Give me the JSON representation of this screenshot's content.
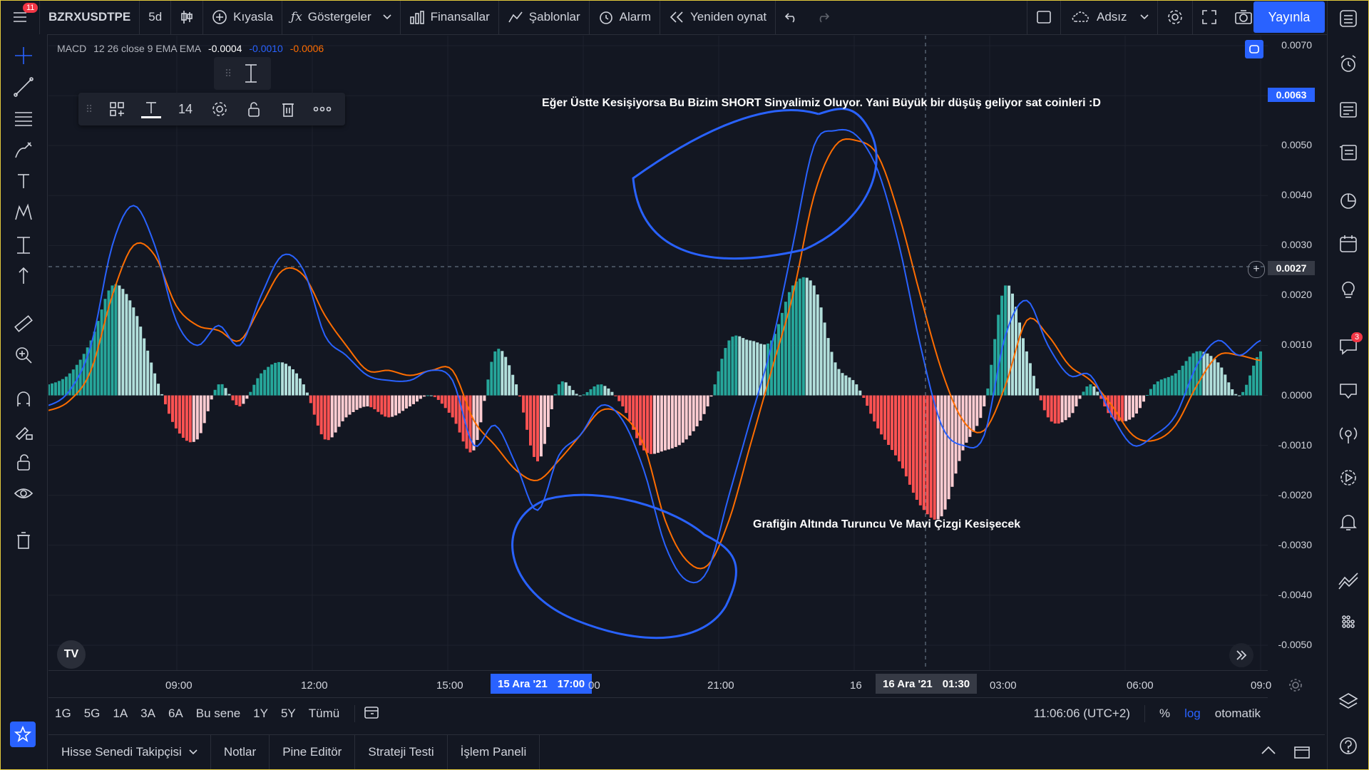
{
  "topbar": {
    "menu_badge": "11",
    "symbol": "BZRXUSDTPE",
    "interval": "5d",
    "compare": "Kıyasla",
    "indicators": "Göstergeler",
    "financials": "Finansallar",
    "templates": "Şablonlar",
    "alarm": "Alarm",
    "replay": "Yeniden oynat",
    "layout_name": "Adsız",
    "publish": "Yayınla"
  },
  "legend": {
    "name": "MACD",
    "params": "12 26 close 9 EMA EMA",
    "v1": "-0.0004",
    "v2": "-0.0010",
    "v3": "-0.0006"
  },
  "float_toolbar": {
    "font_size": "14"
  },
  "yaxis": {
    "labels": [
      "0.0070",
      "0.0060",
      "0.0050",
      "0.0040",
      "0.0030",
      "0.0020",
      "0.0010",
      "0.0000",
      "-0.0010",
      "-0.0020",
      "-0.0030",
      "-0.0040",
      "-0.0050"
    ],
    "top_badge": "0.0063",
    "cursor_badge": "0.0027"
  },
  "xaxis": {
    "labels": [
      "09:00",
      "12:00",
      "15:00",
      "21:00",
      "16",
      "03:00",
      "06:00",
      "09:0"
    ],
    "badge1_date": "15 Ara '21",
    "badge1_time": "17:00",
    "badge1_tail": "00",
    "badge2_date": "16 Ara '21",
    "badge2_time": "01:30"
  },
  "annotations": {
    "top": "Eğer Üstte Kesişiyorsa Bu Bizim SHORT Sinyalimiz Oluyor. Yani Büyük bir düşüş geliyor sat coinleri :D",
    "bottom": "Grafiğin Altında Turuncu Ve Mavi Çizgi Kesişecek"
  },
  "bottombar": {
    "ranges": [
      "1G",
      "5G",
      "1A",
      "3A",
      "6A",
      "Bu sene",
      "1Y",
      "5Y",
      "Tümü"
    ],
    "time": "11:06:06 (UTC+2)",
    "percent": "%",
    "log": "log",
    "auto": "otomatik"
  },
  "panel_tabs": [
    "Hisse Senedi Takipçisi",
    "Notlar",
    "Pine Editör",
    "Strateji Testi",
    "İşlem Paneli"
  ],
  "right_badge": "3",
  "colors": {
    "bg": "#131722",
    "macd_line": "#2962ff",
    "signal_line": "#ff6d00",
    "hist_up_strong": "#26a69a",
    "hist_up_weak": "#b2dfdb",
    "hist_down_strong": "#ff5252",
    "hist_down_weak": "#ffcdd2",
    "accent": "#2962ff"
  },
  "chart_data": {
    "type": "line",
    "title": "",
    "ylim": [
      -0.0055,
      0.0072
    ],
    "series": [
      {
        "name": "MACD",
        "values": [
          -0.0002,
          0.0001,
          0.001,
          0.003,
          0.0038,
          0.003,
          0.0015,
          0.001,
          0.0014,
          0.001,
          0.002,
          0.0028,
          0.0025,
          0.0012,
          0.0008,
          0.0004,
          0.0003,
          0.0003,
          0.0005,
          0.0003,
          -0.001,
          -0.0006,
          -0.0014,
          -0.0023,
          -0.0012,
          -0.0008,
          -0.0002,
          -0.0005,
          -0.0015,
          -0.003,
          -0.0037,
          -0.0035,
          -0.002,
          -0.0005,
          0.001,
          0.003,
          0.005,
          0.0053,
          0.0052,
          0.0045,
          0.003,
          0.001,
          -0.0006,
          -0.001,
          -0.0008,
          0.0012,
          0.0019,
          0.001,
          0.0004,
          0.0004,
          -0.0004,
          -0.001,
          -0.0008,
          -0.0004,
          0.0006,
          0.0011,
          0.0008,
          0.0011
        ]
      },
      {
        "name": "Signal",
        "values": [
          -0.0003,
          -0.0001,
          0.0005,
          0.002,
          0.003,
          0.0028,
          0.0018,
          0.0014,
          0.0013,
          0.0011,
          0.0018,
          0.0025,
          0.0024,
          0.0016,
          0.001,
          0.0005,
          0.0005,
          0.0004,
          0.0005,
          0.0005,
          -0.0005,
          -0.001,
          -0.0015,
          -0.0017,
          -0.0013,
          -0.0008,
          -0.0003,
          -0.0004,
          -0.001,
          -0.0025,
          -0.0033,
          -0.0034,
          -0.0025,
          -0.001,
          0.0005,
          0.002,
          0.004,
          0.005,
          0.0051,
          0.0048,
          0.0036,
          0.002,
          0.0005,
          -0.0005,
          -0.0007,
          0.0002,
          0.0015,
          0.0012,
          0.0006,
          0.0003,
          -0.0002,
          -0.0008,
          -0.0009,
          -0.0006,
          0.0002,
          0.0008,
          0.0008,
          0.0007
        ]
      }
    ]
  }
}
